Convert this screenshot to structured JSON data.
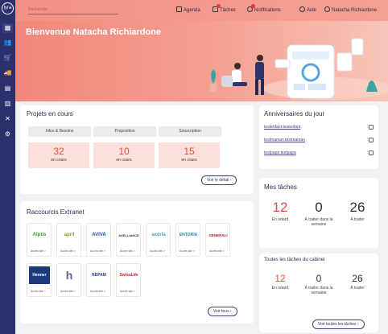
{
  "sidebar": {
    "logo": "lyra",
    "tooltip": "Contacts",
    "icons": [
      "dashboard-icon",
      "contacts-icon",
      "cart-icon",
      "truck-icon",
      "document-icon",
      "calendar-icon",
      "tools-icon",
      "gear-icon"
    ]
  },
  "topbar": {
    "search_placeholder": "Recherche",
    "agenda": "Agenda",
    "taches": "Tâches",
    "notifications": "Notifications",
    "aide": "Aide",
    "user": "Natacha Richiardone"
  },
  "hero": {
    "title": "Bienvenue Natacha Richiardone"
  },
  "projets": {
    "title": "Projets en cours",
    "columns": [
      {
        "label": "Infos & Besoins",
        "count": "32",
        "sub": "en cours"
      },
      {
        "label": "Proposition",
        "count": "10",
        "sub": "en cours"
      },
      {
        "label": "Souscription",
        "count": "15",
        "sub": "en cours"
      }
    ],
    "detail_button": "Voir le détail"
  },
  "raccourcis": {
    "title": "Raccourcis Extranet",
    "access_label": "Accès site >",
    "tiles": [
      {
        "name": "Alptis",
        "color": "#2e9b43"
      },
      {
        "name": "april",
        "color": "#7aa320"
      },
      {
        "name": "AVIVA",
        "color": "#1a4f9c"
      },
      {
        "name": "AXELLIANCE",
        "color": "#333333"
      },
      {
        "name": "axéria",
        "color": "#4a9bd6"
      },
      {
        "name": "ENTORIA",
        "color": "#1c8bb0"
      },
      {
        "name": "GENERALI",
        "color": "#c4161c"
      },
      {
        "name": "Henner",
        "color": "#1b3a7a"
      },
      {
        "name": "h",
        "color": "#6b5a8c"
      },
      {
        "name": "REPAM",
        "color": "#1b3a7a"
      },
      {
        "name": "SwissLife",
        "color": "#d71920"
      }
    ],
    "all_button": "Voir tous"
  },
  "anniversaires": {
    "title": "Anniversaires du jour",
    "items": [
      "testenfant testenfant",
      "testmaman testmaman",
      "testpapa testpapa"
    ]
  },
  "mes_taches": {
    "title": "Mes tâches",
    "items": [
      {
        "value": "12",
        "label": "En retard"
      },
      {
        "value": "0",
        "label": "À traiter dans la semaine"
      },
      {
        "value": "26",
        "label": "À traiter"
      }
    ]
  },
  "cabinet_taches": {
    "title": "Toutes les tâches du cabinet",
    "items": [
      {
        "value": "12",
        "label": "En retard"
      },
      {
        "value": "0",
        "label": "À traiter dans la semaine"
      },
      {
        "value": "26",
        "label": "À traiter"
      }
    ],
    "all_button": "Voir toutes les tâches"
  },
  "colors": {
    "sidebar": "#2b2f6b",
    "accent": "#e74c3c",
    "hero": "#f2877c"
  }
}
